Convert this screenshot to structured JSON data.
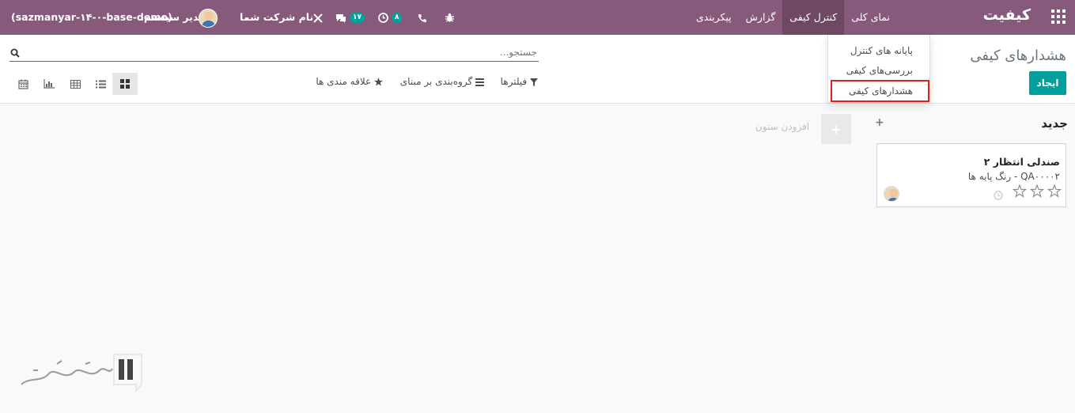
{
  "navbar": {
    "brand": "کیفیت",
    "menu": [
      {
        "label": "نمای کلی",
        "active": false
      },
      {
        "label": "کنترل کیفی",
        "active": true
      },
      {
        "label": "گزارش",
        "active": false
      },
      {
        "label": "پیکربندی",
        "active": false
      }
    ],
    "company": "نام شرکت شما",
    "user": "مدیر سیستم",
    "database": "(sazmanyar-۱۴-۰-base-demo)",
    "messages_count": "۱۷",
    "activities_count": "۸"
  },
  "dropdown": {
    "items": [
      {
        "label": "پایانه های کنترل"
      },
      {
        "label": "بررسی‌های کیفی"
      },
      {
        "label": "هشدارهای کیفی"
      }
    ],
    "highlighted_index": 2,
    "highlight_color": "#e02020"
  },
  "control_panel": {
    "title": "هشدارهای کیفی",
    "create_label": "ایجاد",
    "search_placeholder": "جستجو...",
    "filters_label": "فیلترها",
    "groupby_label": "گروه‌بندی بر مبنای",
    "favorites_label": "علاقه مندی ها",
    "views": [
      "kanban",
      "list",
      "pivot",
      "graph",
      "calendar"
    ],
    "active_view": "kanban"
  },
  "kanban": {
    "column_title": "جدید",
    "add_column_label": "افزودن ستون",
    "cards": [
      {
        "title": "صندلی انتظار ۲",
        "subtitle": "QA۰۰۰۰۲ - رنگ پایه ها",
        "stars": 0,
        "max_stars": 3
      }
    ]
  },
  "colors": {
    "navbar": "#875a7b",
    "navbar_active": "#6f4963",
    "accent": "#00a09d"
  }
}
